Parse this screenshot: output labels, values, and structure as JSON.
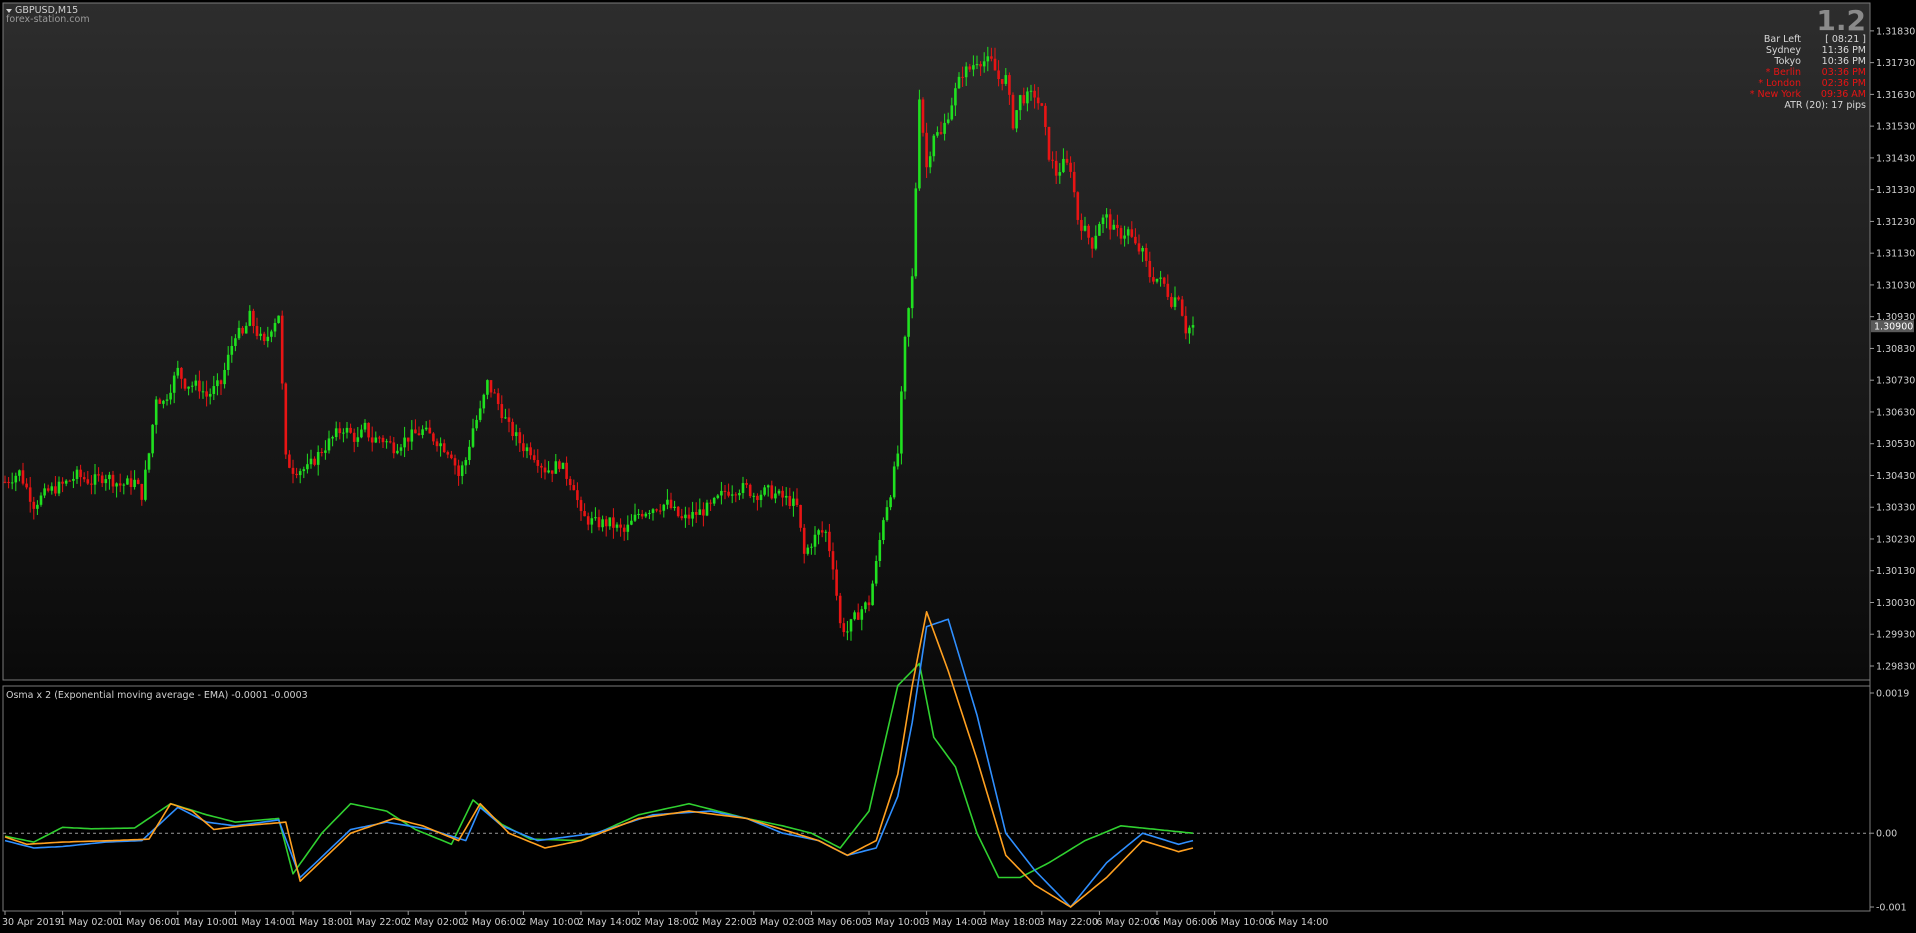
{
  "window": {
    "symbol": "GBPUSD,M15",
    "watermark": "forex-station.com"
  },
  "info_panel": {
    "big_value": "1.2",
    "rows": [
      {
        "label": "Bar Left",
        "value": "[ 08:21 ]",
        "color": "#d8d8d8"
      },
      {
        "label": "Sydney",
        "value": "11:36 PM",
        "color": "#d8d8d8"
      },
      {
        "label": "Tokyo",
        "value": "10:36 PM",
        "color": "#d8d8d8"
      },
      {
        "label": "* Berlin",
        "value": "03:36 PM",
        "color": "#e81414"
      },
      {
        "label": "* London",
        "value": "02:36 PM",
        "color": "#e81414"
      },
      {
        "label": "* New York",
        "value": "09:36 AM",
        "color": "#e81414"
      }
    ],
    "atr": "ATR (20): 17 pips"
  },
  "indicator": {
    "label": "Osma x 2 (Exponential moving average - EMA) -0.0001 -0.0003"
  },
  "colors": {
    "up": "#20e020",
    "down": "#e81414",
    "osma_green": "#30d030",
    "osma_blue": "#2f8fff",
    "osma_orange": "#ffa020",
    "zero_line": "#9a9a9a",
    "grid_frame": "#7a7a7a",
    "current_price_bg": "#5a5a5a"
  },
  "chart_data": [
    {
      "type": "candlestick",
      "title": "GBPUSD,M15",
      "ylim": [
        1.2983,
        1.3188
      ],
      "y_ticks": [
        "1.31830",
        "1.31730",
        "1.31630",
        "1.31530",
        "1.31430",
        "1.31330",
        "1.31230",
        "1.31130",
        "1.31030",
        "1.30930",
        "1.30830",
        "1.30730",
        "1.30630",
        "1.30530",
        "1.30430",
        "1.30330",
        "1.30230",
        "1.30130",
        "1.30030",
        "1.29930",
        "1.29830"
      ],
      "current_price": "1.30900",
      "x_ticks": [
        "30 Apr 2019",
        "1 May 02:00",
        "1 May 06:00",
        "1 May 10:00",
        "1 May 14:00",
        "1 May 18:00",
        "1 May 22:00",
        "2 May 02:00",
        "2 May 06:00",
        "2 May 10:00",
        "2 May 14:00",
        "2 May 18:00",
        "2 May 22:00",
        "3 May 02:00",
        "3 May 06:00",
        "3 May 10:00",
        "3 May 14:00",
        "3 May 18:00",
        "3 May 22:00",
        "6 May 02:00",
        "6 May 06:00",
        "6 May 10:00",
        "6 May 14:00"
      ],
      "bars_per_tick": 16,
      "close_anchors": [
        [
          0,
          1.3041
        ],
        [
          4,
          1.3044
        ],
        [
          8,
          1.3034
        ],
        [
          12,
          1.3038
        ],
        [
          16,
          1.304
        ],
        [
          20,
          1.3043
        ],
        [
          24,
          1.3041
        ],
        [
          28,
          1.3043
        ],
        [
          32,
          1.304
        ],
        [
          36,
          1.3041
        ],
        [
          38,
          1.3037
        ],
        [
          40,
          1.305
        ],
        [
          42,
          1.3068
        ],
        [
          44,
          1.3066
        ],
        [
          48,
          1.3076
        ],
        [
          50,
          1.3072
        ],
        [
          54,
          1.3071
        ],
        [
          56,
          1.3068
        ],
        [
          58,
          1.307
        ],
        [
          60,
          1.3072
        ],
        [
          62,
          1.308
        ],
        [
          64,
          1.3088
        ],
        [
          66,
          1.3087
        ],
        [
          68,
          1.3093
        ],
        [
          70,
          1.3088
        ],
        [
          72,
          1.3084
        ],
        [
          74,
          1.309
        ],
        [
          76,
          1.3094
        ],
        [
          78,
          1.3048
        ],
        [
          80,
          1.3045
        ],
        [
          84,
          1.3045
        ],
        [
          88,
          1.3051
        ],
        [
          92,
          1.3056
        ],
        [
          94,
          1.3058
        ],
        [
          98,
          1.3054
        ],
        [
          100,
          1.3058
        ],
        [
          102,
          1.3054
        ],
        [
          104,
          1.3055
        ],
        [
          108,
          1.3052
        ],
        [
          112,
          1.3055
        ],
        [
          116,
          1.3057
        ],
        [
          120,
          1.3054
        ],
        [
          124,
          1.305
        ],
        [
          126,
          1.3043
        ],
        [
          128,
          1.3048
        ],
        [
          130,
          1.3058
        ],
        [
          132,
          1.3063
        ],
        [
          134,
          1.3072
        ],
        [
          136,
          1.3068
        ],
        [
          140,
          1.3058
        ],
        [
          144,
          1.3052
        ],
        [
          146,
          1.3051
        ],
        [
          150,
          1.3045
        ],
        [
          152,
          1.3045
        ],
        [
          154,
          1.3047
        ],
        [
          156,
          1.3043
        ],
        [
          158,
          1.304
        ],
        [
          160,
          1.303
        ],
        [
          164,
          1.3028
        ],
        [
          168,
          1.3028
        ],
        [
          172,
          1.3025
        ],
        [
          176,
          1.3031
        ],
        [
          180,
          1.3033
        ],
        [
          184,
          1.3034
        ],
        [
          188,
          1.3029
        ],
        [
          192,
          1.3031
        ],
        [
          196,
          1.3033
        ],
        [
          200,
          1.3038
        ],
        [
          204,
          1.3039
        ],
        [
          206,
          1.3039
        ],
        [
          208,
          1.3037
        ],
        [
          212,
          1.3038
        ],
        [
          216,
          1.3036
        ],
        [
          218,
          1.3035
        ],
        [
          220,
          1.3033
        ],
        [
          222,
          1.3018
        ],
        [
          224,
          1.3022
        ],
        [
          226,
          1.3025
        ],
        [
          228,
          1.3025
        ],
        [
          230,
          1.3015
        ],
        [
          232,
          1.2996
        ],
        [
          234,
          1.2994
        ],
        [
          236,
          1.2998
        ],
        [
          238,
          1.3001
        ],
        [
          240,
          1.3003
        ],
        [
          242,
          1.3015
        ],
        [
          244,
          1.303
        ],
        [
          246,
          1.3038
        ],
        [
          248,
          1.305
        ],
        [
          250,
          1.3085
        ],
        [
          252,
          1.3105
        ],
        [
          254,
          1.3163
        ],
        [
          256,
          1.314
        ],
        [
          258,
          1.3151
        ],
        [
          260,
          1.315
        ],
        [
          262,
          1.3157
        ],
        [
          264,
          1.3164
        ],
        [
          266,
          1.317
        ],
        [
          268,
          1.3171
        ],
        [
          270,
          1.3174
        ],
        [
          274,
          1.3173
        ],
        [
          276,
          1.3168
        ],
        [
          278,
          1.3168
        ],
        [
          280,
          1.3154
        ],
        [
          282,
          1.3162
        ],
        [
          284,
          1.3162
        ],
        [
          286,
          1.3163
        ],
        [
          288,
          1.3158
        ],
        [
          290,
          1.3144
        ],
        [
          292,
          1.3138
        ],
        [
          294,
          1.3141
        ],
        [
          296,
          1.314
        ],
        [
          298,
          1.3124
        ],
        [
          300,
          1.312
        ],
        [
          302,
          1.3116
        ],
        [
          304,
          1.3123
        ],
        [
          306,
          1.3124
        ],
        [
          308,
          1.312
        ],
        [
          310,
          1.3119
        ],
        [
          312,
          1.312
        ],
        [
          314,
          1.3115
        ],
        [
          316,
          1.3113
        ],
        [
          318,
          1.3106
        ],
        [
          320,
          1.3105
        ],
        [
          322,
          1.3103
        ],
        [
          324,
          1.3098
        ],
        [
          326,
          1.31
        ],
        [
          328,
          1.3089
        ],
        [
          330,
          1.309
        ]
      ],
      "close_at_tick": [
        1.3041,
        1.304,
        1.304,
        1.3072,
        1.308,
        1.3094,
        1.3045,
        1.3056,
        1.3055,
        1.3054,
        1.3045,
        1.3028,
        1.3031,
        1.3038,
        1.3036,
        1.3003,
        1.305,
        1.317,
        1.3154,
        1.314,
        1.3116,
        1.3105,
        1.309
      ],
      "series": [
        {
          "name": "up"
        },
        {
          "name": "down"
        }
      ]
    },
    {
      "type": "line",
      "title": "Osma x 2 (Exponential moving average - EMA) -0.0001 -0.0003",
      "ylim": [
        -0.001,
        0.0019
      ],
      "y_ticks": [
        "0.0019",
        "0.00",
        "-0.001"
      ],
      "series": [
        {
          "name": "green",
          "color": "#30d030",
          "anchors": [
            [
              0,
              -4e-05
            ],
            [
              8,
              -0.00012
            ],
            [
              16,
              8e-05
            ],
            [
              24,
              6e-05
            ],
            [
              36,
              7e-05
            ],
            [
              46,
              0.0004
            ],
            [
              56,
              0.00025
            ],
            [
              64,
              0.00015
            ],
            [
              76,
              0.0002
            ],
            [
              80,
              -0.00055
            ],
            [
              88,
              0.0
            ],
            [
              96,
              0.0004
            ],
            [
              106,
              0.0003
            ],
            [
              114,
              5e-05
            ],
            [
              124,
              -0.00015
            ],
            [
              130,
              0.00045
            ],
            [
              138,
              0.00012
            ],
            [
              146,
              -8e-05
            ],
            [
              160,
              -0.0001
            ],
            [
              176,
              0.00025
            ],
            [
              190,
              0.0004
            ],
            [
              206,
              0.0002
            ],
            [
              216,
              0.0001
            ],
            [
              224,
              0.0
            ],
            [
              232,
              -0.0002
            ],
            [
              240,
              0.0003
            ],
            [
              248,
              0.002
            ],
            [
              254,
              0.0023
            ],
            [
              258,
              0.0013
            ],
            [
              264,
              0.0009
            ],
            [
              270,
              0.0
            ],
            [
              276,
              -0.0006
            ],
            [
              282,
              -0.0006
            ],
            [
              290,
              -0.0004
            ],
            [
              300,
              -0.0001
            ],
            [
              310,
              0.0001
            ],
            [
              320,
              5e-05
            ],
            [
              330,
              0.0
            ]
          ]
        },
        {
          "name": "blue",
          "color": "#2f8fff",
          "anchors": [
            [
              0,
              -0.0001
            ],
            [
              8,
              -0.0002
            ],
            [
              16,
              -0.00018
            ],
            [
              28,
              -0.00012
            ],
            [
              38,
              -0.0001
            ],
            [
              48,
              0.00035
            ],
            [
              56,
              0.00015
            ],
            [
              64,
              0.0001
            ],
            [
              76,
              0.00018
            ],
            [
              82,
              -0.0006
            ],
            [
              96,
              5e-05
            ],
            [
              106,
              0.00015
            ],
            [
              118,
              5e-05
            ],
            [
              128,
              -0.0001
            ],
            [
              132,
              0.00035
            ],
            [
              138,
              0.0001
            ],
            [
              148,
              -0.0001
            ],
            [
              164,
              0.0
            ],
            [
              180,
              0.00025
            ],
            [
              196,
              0.0003
            ],
            [
              206,
              0.0002
            ],
            [
              216,
              0.0
            ],
            [
              226,
              -0.0001
            ],
            [
              234,
              -0.0003
            ],
            [
              242,
              -0.0002
            ],
            [
              248,
              0.0005
            ],
            [
              252,
              0.0015
            ],
            [
              256,
              0.0028
            ],
            [
              262,
              0.0029
            ],
            [
              270,
              0.0016
            ],
            [
              278,
              0.0
            ],
            [
              286,
              -0.0005
            ],
            [
              296,
              -0.001
            ],
            [
              306,
              -0.0004
            ],
            [
              316,
              0.0
            ],
            [
              326,
              -0.00015
            ],
            [
              330,
              -0.0001
            ]
          ]
        },
        {
          "name": "orange",
          "color": "#ffa020",
          "anchors": [
            [
              0,
              -5e-05
            ],
            [
              6,
              -0.00015
            ],
            [
              16,
              -0.00012
            ],
            [
              30,
              -0.0001
            ],
            [
              40,
              -8e-05
            ],
            [
              46,
              0.0004
            ],
            [
              52,
              0.0003
            ],
            [
              58,
              5e-05
            ],
            [
              66,
              0.0001
            ],
            [
              78,
              0.00015
            ],
            [
              82,
              -0.00065
            ],
            [
              96,
              0.0
            ],
            [
              108,
              0.0002
            ],
            [
              116,
              0.0001
            ],
            [
              126,
              -0.0001
            ],
            [
              132,
              0.0004
            ],
            [
              140,
              0.0
            ],
            [
              150,
              -0.0002
            ],
            [
              160,
              -0.0001
            ],
            [
              176,
              0.0002
            ],
            [
              190,
              0.0003
            ],
            [
              206,
              0.0002
            ],
            [
              216,
              5e-05
            ],
            [
              226,
              -0.0001
            ],
            [
              234,
              -0.0003
            ],
            [
              242,
              -0.0001
            ],
            [
              248,
              0.0008
            ],
            [
              252,
              0.002
            ],
            [
              256,
              0.003
            ],
            [
              262,
              0.0022
            ],
            [
              270,
              0.001
            ],
            [
              278,
              -0.0003
            ],
            [
              286,
              -0.0007
            ],
            [
              296,
              -0.001
            ],
            [
              306,
              -0.0006
            ],
            [
              316,
              -0.0001
            ],
            [
              326,
              -0.00025
            ],
            [
              330,
              -0.0002
            ]
          ]
        }
      ]
    }
  ]
}
